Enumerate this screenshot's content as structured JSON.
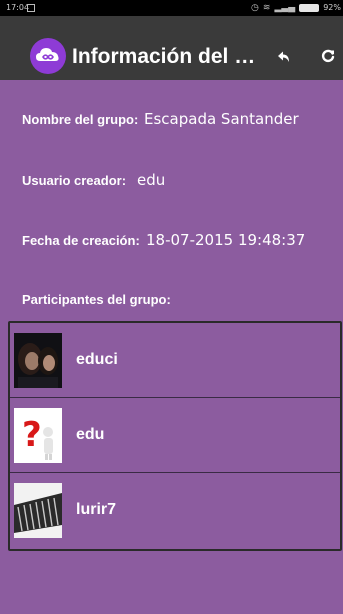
{
  "status_bar": {
    "time": "17:04",
    "battery": "92%"
  },
  "app_bar": {
    "title": "Información del gr...",
    "logo_icon": "infinity-cloud-icon",
    "back_icon": "back-arrow-icon",
    "refresh_icon": "refresh-icon",
    "background": "#3a3a3a"
  },
  "group_info": {
    "name_label": "Nombre del grupo:",
    "name_value": "Escapada Santander",
    "creator_label": "Usuario creador:",
    "creator_value": "edu",
    "date_label": "Fecha de creación:",
    "date_value": "18-07-2015 19:48:37",
    "participants_label": "Participantes del grupo:"
  },
  "participants": [
    {
      "name": "educi",
      "avatar": "couple-photo"
    },
    {
      "name": "edu",
      "avatar": "question-mark-figure"
    },
    {
      "name": "lurir7",
      "avatar": "stack-of-documents-photo"
    }
  ],
  "colors": {
    "background": "#8c5c9f",
    "accent": "#8e3bd6"
  }
}
